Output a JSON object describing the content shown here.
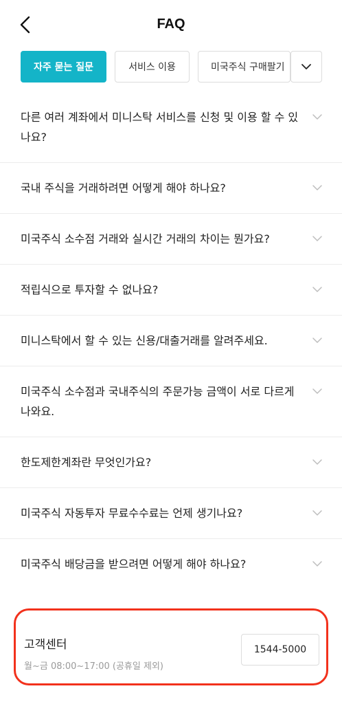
{
  "header": {
    "title": "FAQ",
    "back_icon": "chevron-left-icon"
  },
  "tabs": [
    {
      "label": "자주 묻는 질문",
      "active": true
    },
    {
      "label": "서비스 이용",
      "active": false
    },
    {
      "label": "미국주식 구매팔기",
      "active": false
    }
  ],
  "tab_more_icon": "chevron-down-icon",
  "faq": [
    {
      "question": "다른 여러 계좌에서 미니스탁 서비스를 신청 및 이용 할 수 있나요?"
    },
    {
      "question": "국내 주식을 거래하려면 어떻게 해야 하나요?"
    },
    {
      "question": "미국주식 소수점 거래와 실시간 거래의 차이는 뭔가요?"
    },
    {
      "question": "적립식으로 투자할 수 없나요?"
    },
    {
      "question": "미니스탁에서 할 수 있는 신용/대출거래를 알려주세요."
    },
    {
      "question": "미국주식 소수점과 국내주식의 주문가능 금액이 서로 다르게 나와요."
    },
    {
      "question": "한도제한계좌란 무엇인가요?"
    },
    {
      "question": "미국주식 자동투자 무료수수료는 언제 생기나요?"
    },
    {
      "question": "미국주식 배당금을 받으려면 어떻게 해야 하나요?"
    }
  ],
  "support": {
    "title": "고객센터",
    "hours": "월~금 08:00~17:00 (공휴일 제외)",
    "phone": "1544-5000"
  },
  "colors": {
    "accent": "#14b4c8",
    "highlight_border": "#f2311c"
  }
}
